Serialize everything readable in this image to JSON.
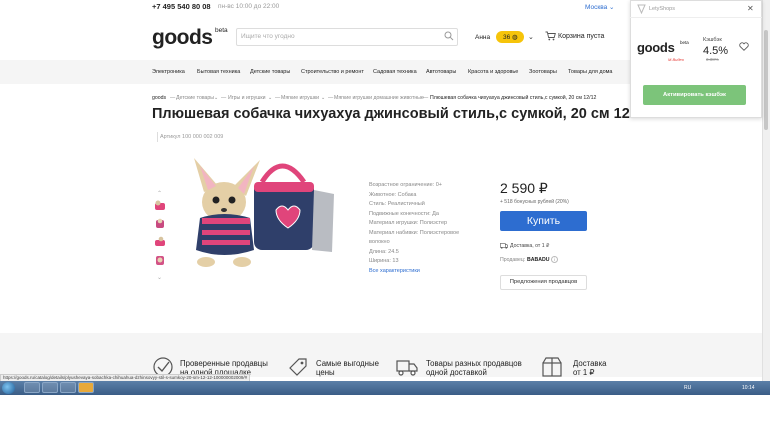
{
  "topbar": {
    "phone": "+7 495 540 80 08",
    "hours": "пн-вс 10:00 до 22:00",
    "city": "Москва"
  },
  "header": {
    "logo": "goods",
    "logo_beta": "beta",
    "search_placeholder": "Ищите что угодно",
    "user_name": "Анна",
    "bonus_count": "36",
    "cart_label": "Корзина пуста"
  },
  "nav": {
    "items": [
      "Электроника",
      "Бытовая техника",
      "Детские товары",
      "Строительство и ремонт",
      "Садовая техника",
      "Автотовары",
      "Красота и здоровье",
      "Зоотовары",
      "Товары для дома"
    ]
  },
  "breadcrumb": {
    "items": [
      "goods",
      "Детские товары",
      "Игры и игрушки",
      "Мягкие игрушки",
      "Мягкие игрушки домашние животные",
      "Плюшевая собачка чихуахуа джинсовый стиль,с сумкой, 20 см 12/12"
    ]
  },
  "product": {
    "title": "Плюшевая собачка чихуахуа джинсовый стиль,с сумкой, 20 см 12/12",
    "article": "Артикул 100 000 002 009",
    "specs": [
      "Возрастное ограничение: 0+",
      "Животное: Собака",
      "Стиль: Реалистичный",
      "Подвижные конечности: Да",
      "Материал игрушки: Полиэстер",
      "Материал набивки: Полиэстеровое",
      "волокно",
      "Длина: 24.5",
      "Ширина: 13"
    ],
    "all_specs_link": "Все характеристики",
    "price": "2 590 ₽",
    "bonus_text": "+ 518 бонусных рублей (20%)",
    "buy_label": "Купить",
    "delivery": "Доставка, от 1 ₽",
    "seller_label": "Продавец:",
    "seller_name": "BABADU",
    "seller_info": "i",
    "offers_label": "Предложения продавцов"
  },
  "features": [
    {
      "line1": "Проверенные продавцы",
      "line2": "на одной площадке",
      "icon": "check-icon"
    },
    {
      "line1": "Самые выгодные",
      "line2": "цены",
      "icon": "price-tag-icon"
    },
    {
      "line1": "Товары разных продавцов",
      "line2": "одной доставкой",
      "icon": "truck-icon"
    },
    {
      "line1": "Доставка",
      "line2": "от 1 ₽",
      "icon": "box-icon"
    }
  ],
  "status_url": "https://goods.ru/catalog/details/plyushevaya-sobachka-chihuahua-dzhinsovyy-stil-s-sumkoy-20-sm-12-12-100000002009/#",
  "taskbar": {
    "lang": "RU",
    "time": "10:14"
  },
  "extension": {
    "title": "LetyShops",
    "store_logo": "goods",
    "store_beta": "beta",
    "store_sub": "М.Видео",
    "cashback_label": "Кэшбэк",
    "cashback_value": "4.5%",
    "cashback_old": "3.38%",
    "activate_label": "Активировать кэшбэк"
  },
  "colors": {
    "accent": "#2d6dd0",
    "bonus_yellow": "#f6c40a",
    "activate_green": "#7cc47a"
  }
}
